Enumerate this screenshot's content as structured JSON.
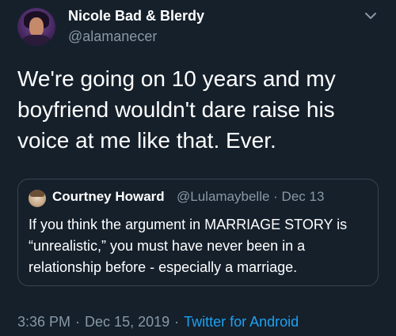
{
  "tweet": {
    "author_name": "Nicole Bad & Blerdy",
    "author_handle": "@alamanecer",
    "text": "We're going on 10 years and my boyfriend wouldn't dare raise his voice at me like that. Ever.",
    "quoted": {
      "author_name": "Courtney Howard",
      "author_handle_date": "@Lulamaybelle · Dec 13",
      "text": "If you think the argument in MARRIAGE STORY is “unrealistic,” you must have never been in a relationship before - especially a marriage."
    },
    "time": "3:36 PM",
    "date": "Dec 15, 2019",
    "separator": "·",
    "source": "Twitter for Android"
  },
  "icons": {
    "menu": "chevron-down-icon"
  },
  "colors": {
    "background": "#15202b",
    "secondary_text": "#8899a6",
    "link": "#1da1f2",
    "border": "#38444d"
  }
}
